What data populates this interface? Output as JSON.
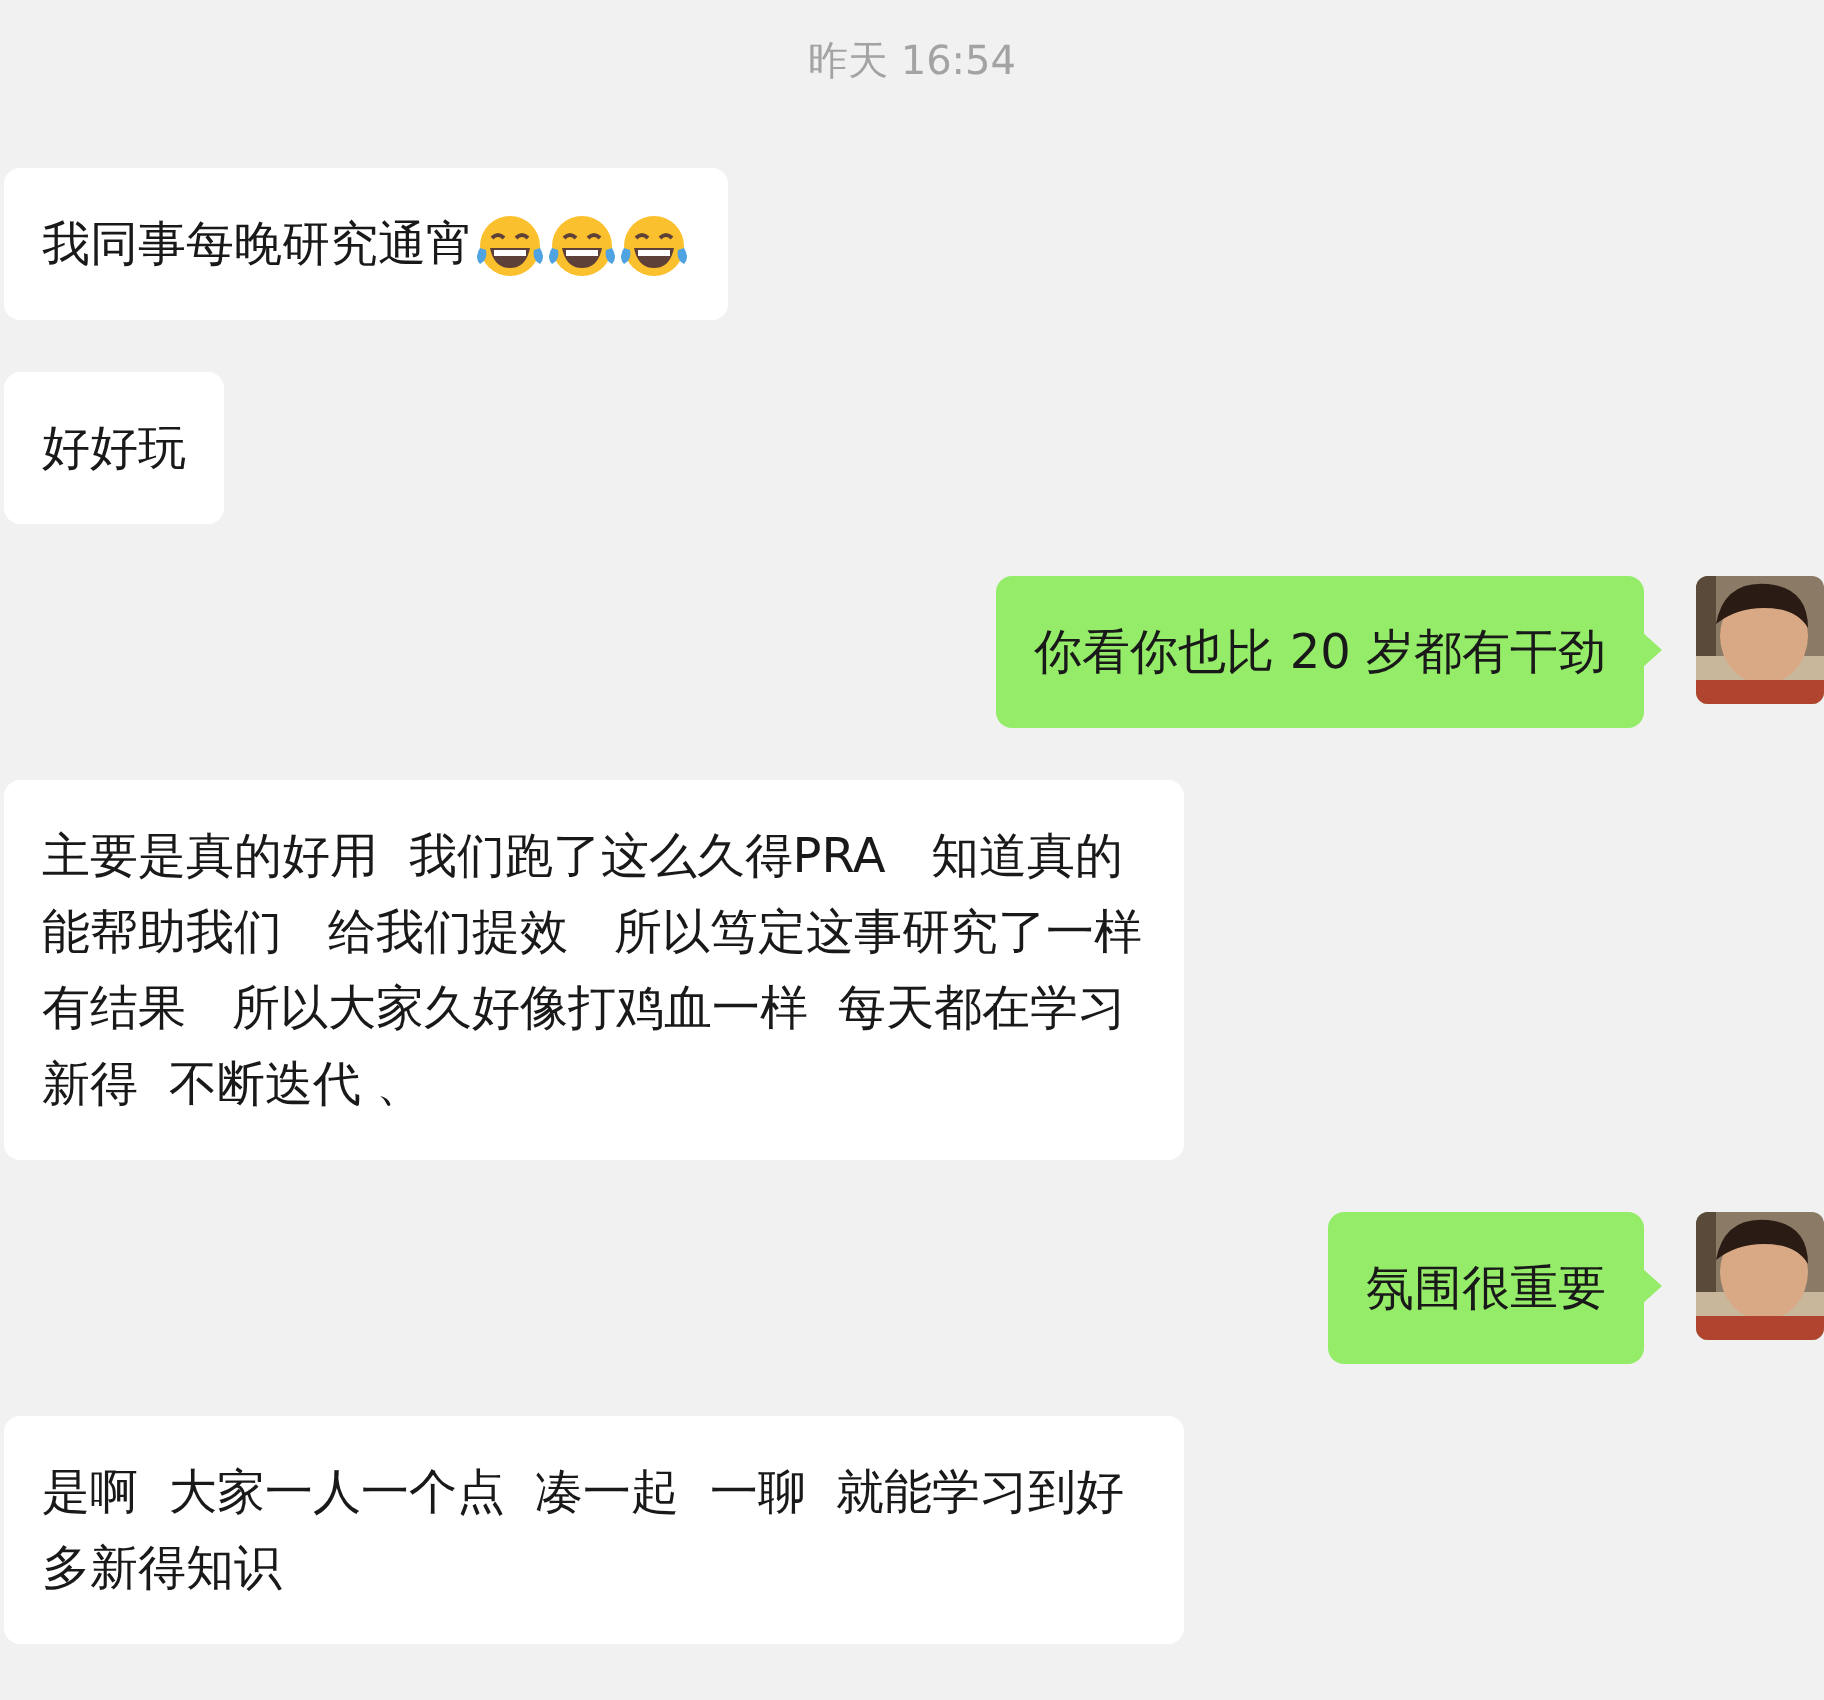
{
  "timestamp": "昨天 16:54",
  "messages": [
    {
      "kind": "incoming",
      "text": "我同事每晚研究通宵",
      "emojis": [
        {
          "kind": "tears-of-joy"
        },
        {
          "kind": "tears-of-joy"
        },
        {
          "kind": "tears-of-joy"
        }
      ]
    },
    {
      "kind": "incoming",
      "text": "好好玩"
    },
    {
      "kind": "outgoing",
      "text": "你看你也比 20 岁都有干劲"
    },
    {
      "kind": "incoming",
      "text": "主要是真的好用  我们跑了这么久得PRA   知道真的能帮助我们   给我们提效   所以笃定这事研究了一样有结果   所以大家久好像打鸡血一样  每天都在学习新得  不断迭代 、"
    },
    {
      "kind": "outgoing",
      "text": "氛围很重要"
    },
    {
      "kind": "incoming",
      "text": "是啊  大家一人一个点  凑一起  一聊  就能学习到好多新得知识"
    }
  ]
}
